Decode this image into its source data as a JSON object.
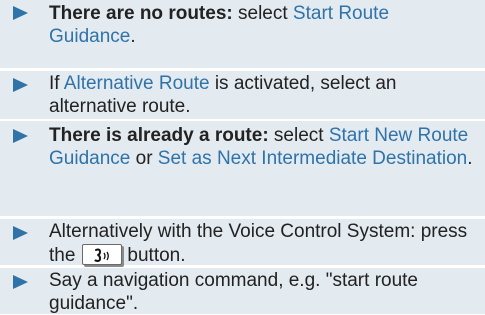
{
  "colors": {
    "row_background": "#e3eaf0",
    "accent_blue": "#2f73a8",
    "text": "#222222"
  },
  "items": [
    {
      "bold": "There are no routes:",
      "text1": " select ",
      "link1": "Start Route Guidance",
      "text2": "."
    },
    {
      "text1": "If ",
      "link1": "Alternative Route",
      "text2": " is activated, select an alternative route."
    },
    {
      "bold": "There is already a route:",
      "text1": " select ",
      "link1": "Start New Route Guidance",
      "text2": " or ",
      "link2": "Set as Next Intermediate Destination",
      "text3": "."
    },
    {
      "text1": "Alternatively with the Voice Control System: press the",
      "button_icon": "voice-control-icon",
      "text2": "button."
    },
    {
      "text1": "Say a navigation command, e.g. \"start route guidance\"."
    }
  ]
}
